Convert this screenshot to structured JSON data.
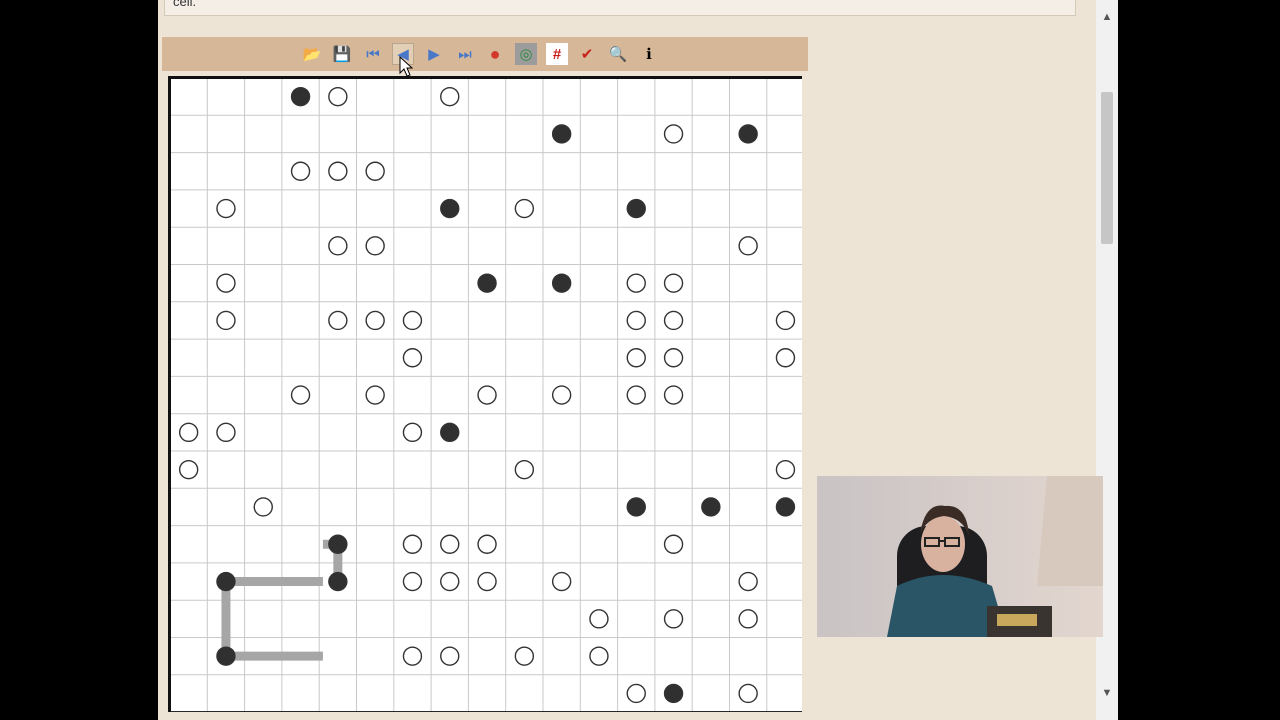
{
  "top_note": {
    "text": "cell."
  },
  "toolbar": {
    "buttons": [
      {
        "name": "open-icon",
        "glyph": "📂"
      },
      {
        "name": "save-icon",
        "glyph": "💾"
      },
      {
        "name": "first-step-icon",
        "glyph": "⏮"
      },
      {
        "name": "previous-step-icon",
        "glyph": "◀"
      },
      {
        "name": "next-step-icon",
        "glyph": "▶"
      },
      {
        "name": "last-step-icon",
        "glyph": "⏭"
      },
      {
        "name": "color-wheel-icon",
        "glyph": "●"
      },
      {
        "name": "target-icon",
        "glyph": "◎"
      },
      {
        "name": "grid-hash-icon",
        "glyph": "#"
      },
      {
        "name": "check-icon",
        "glyph": "✔"
      },
      {
        "name": "zoom-icon",
        "glyph": "🔍"
      },
      {
        "name": "info-icon",
        "glyph": "ℹ"
      }
    ]
  },
  "puzzle": {
    "rows": 17,
    "cols": 17,
    "black": [
      [
        0,
        3
      ],
      [
        1,
        10
      ],
      [
        1,
        15
      ],
      [
        3,
        7
      ],
      [
        3,
        12
      ],
      [
        5,
        8
      ],
      [
        5,
        10
      ],
      [
        9,
        7
      ],
      [
        11,
        12
      ],
      [
        11,
        14
      ],
      [
        11,
        16
      ],
      [
        12,
        4
      ],
      [
        13,
        1
      ],
      [
        13,
        4
      ],
      [
        15,
        1
      ],
      [
        16,
        13
      ]
    ],
    "white": [
      [
        0,
        4
      ],
      [
        0,
        7
      ],
      [
        1,
        13
      ],
      [
        2,
        3
      ],
      [
        2,
        4
      ],
      [
        2,
        5
      ],
      [
        3,
        1
      ],
      [
        3,
        9
      ],
      [
        4,
        4
      ],
      [
        4,
        5
      ],
      [
        4,
        15
      ],
      [
        5,
        1
      ],
      [
        5,
        12
      ],
      [
        5,
        13
      ],
      [
        6,
        1
      ],
      [
        6,
        4
      ],
      [
        6,
        5
      ],
      [
        6,
        6
      ],
      [
        6,
        12
      ],
      [
        6,
        13
      ],
      [
        6,
        16
      ],
      [
        7,
        6
      ],
      [
        7,
        12
      ],
      [
        7,
        13
      ],
      [
        7,
        16
      ],
      [
        8,
        3
      ],
      [
        8,
        5
      ],
      [
        8,
        8
      ],
      [
        8,
        10
      ],
      [
        8,
        12
      ],
      [
        8,
        13
      ],
      [
        9,
        0
      ],
      [
        9,
        1
      ],
      [
        9,
        6
      ],
      [
        10,
        0
      ],
      [
        10,
        9
      ],
      [
        10,
        16
      ],
      [
        11,
        2
      ],
      [
        12,
        6
      ],
      [
        12,
        7
      ],
      [
        12,
        8
      ],
      [
        12,
        13
      ],
      [
        13,
        6
      ],
      [
        13,
        7
      ],
      [
        13,
        8
      ],
      [
        13,
        10
      ],
      [
        13,
        15
      ],
      [
        14,
        11
      ],
      [
        14,
        13
      ],
      [
        14,
        15
      ],
      [
        15,
        6
      ],
      [
        15,
        7
      ],
      [
        15,
        9
      ],
      [
        15,
        11
      ],
      [
        16,
        12
      ],
      [
        16,
        15
      ]
    ],
    "lines": [
      {
        "from": [
          12,
          4
        ],
        "to": [
          12,
          3.6
        ]
      },
      {
        "from": [
          12,
          4
        ],
        "to": [
          13,
          4
        ]
      },
      {
        "from": [
          13,
          1
        ],
        "to": [
          13,
          3.6
        ]
      },
      {
        "from": [
          13,
          1
        ],
        "to": [
          15,
          1
        ]
      },
      {
        "from": [
          15,
          1
        ],
        "to": [
          15,
          3.6
        ]
      }
    ],
    "colors": {
      "grid": "#c9c9c9",
      "black": "#303030",
      "white": "#ffffff",
      "line": "#a6a6a6"
    }
  },
  "webcam": {
    "description": "presenter-video"
  }
}
